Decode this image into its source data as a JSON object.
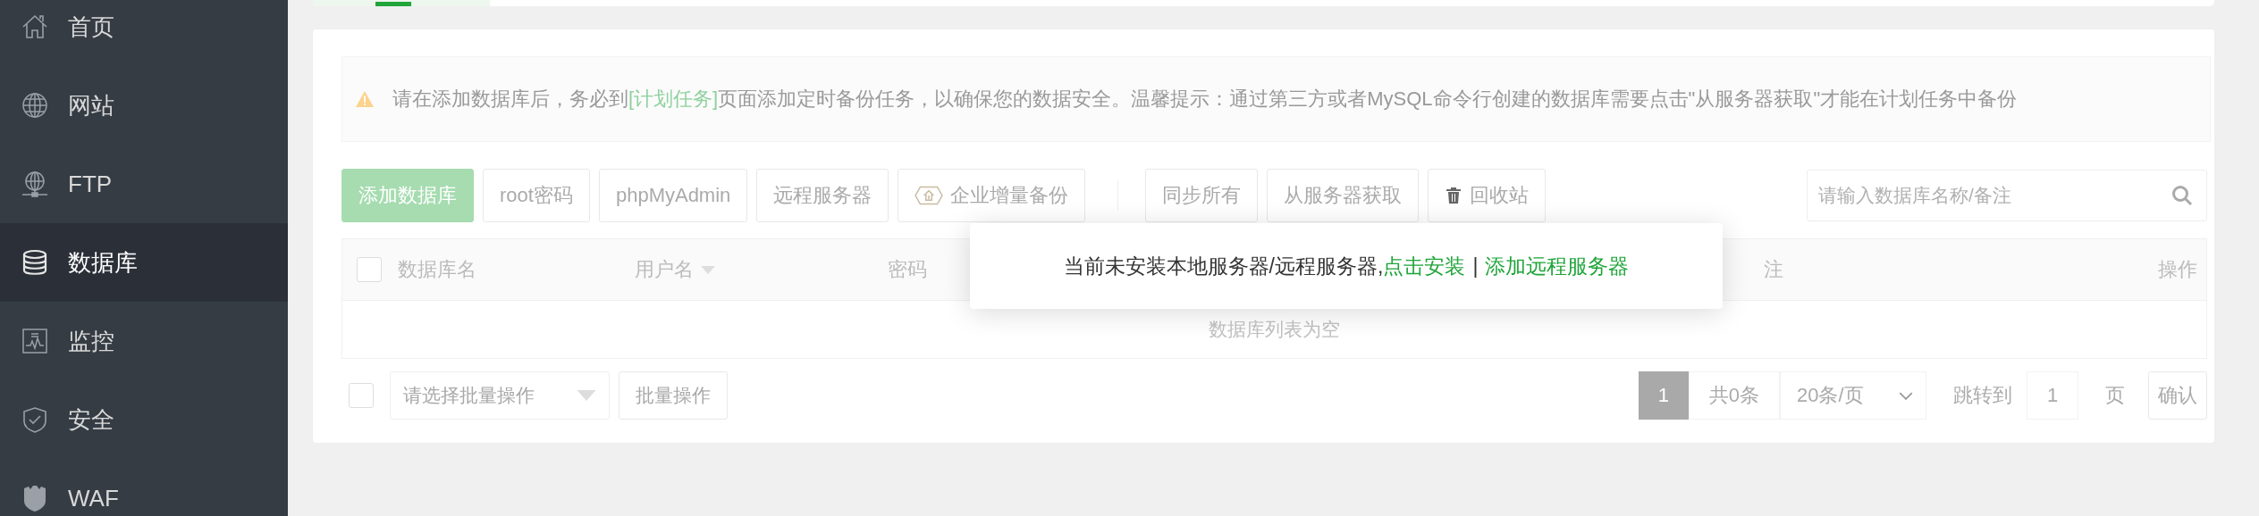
{
  "sidebar": {
    "items": [
      {
        "label": "首页",
        "kind": "home",
        "selected": false
      },
      {
        "label": "网站",
        "kind": "globe",
        "selected": false
      },
      {
        "label": "FTP",
        "kind": "ftp",
        "selected": false
      },
      {
        "label": "数据库",
        "kind": "database",
        "selected": true
      },
      {
        "label": "监控",
        "kind": "monitor",
        "selected": false
      },
      {
        "label": "安全",
        "kind": "shield",
        "selected": false
      },
      {
        "label": "WAF",
        "kind": "waf",
        "selected": false
      }
    ]
  },
  "alert": {
    "before": "请在添加数据库后，务必到",
    "link": "[计划任务]",
    "after": "页面添加定时备份任务，以确保您的数据安全。温馨提示：通过第三方或者MySQL命令行创建的数据库需要点击\"从服务器获取\"才能在计划任务中备份"
  },
  "toolbar": {
    "left_buttons": [
      {
        "label": "添加数据库",
        "kind": "primary"
      },
      {
        "label": "root密码",
        "kind": "plain"
      },
      {
        "label": "phpMyAdmin",
        "kind": "plain"
      },
      {
        "label": "远程服务器",
        "kind": "plain"
      },
      {
        "label": "企业增量备份",
        "kind": "enterprise"
      }
    ],
    "right_buttons": [
      {
        "label": "同步所有",
        "kind": "plain"
      },
      {
        "label": "从服务器获取",
        "kind": "plain"
      },
      {
        "label": "回收站",
        "kind": "trash"
      }
    ],
    "search": {
      "placeholder": "请输入数据库名称/备注"
    }
  },
  "table": {
    "columns": [
      {
        "label": "数据库名",
        "sortable": false
      },
      {
        "label": "用户名",
        "sortable": true
      },
      {
        "label": "密码",
        "sortable": false
      },
      {
        "label": "注",
        "sortable": false
      },
      {
        "label": "操作",
        "sortable": false
      }
    ],
    "select_all_checked": false,
    "empty_text": "数据库列表为空"
  },
  "footer": {
    "select_all_checked": false,
    "batch_select": {
      "placeholder": "请选择批量操作"
    },
    "batch_button": "批量操作",
    "pagination": {
      "current_page": "1",
      "total": "共0条",
      "page_size": "20条/页",
      "jump_label": "跳转到",
      "jump_value": "1",
      "page_unit": "页",
      "confirm": "确认"
    }
  },
  "popup": {
    "text": "当前未安装本地服务器/远程服务器,",
    "install_link": "点击安装",
    "separator": "|",
    "remote_link": "添加远程服务器"
  }
}
